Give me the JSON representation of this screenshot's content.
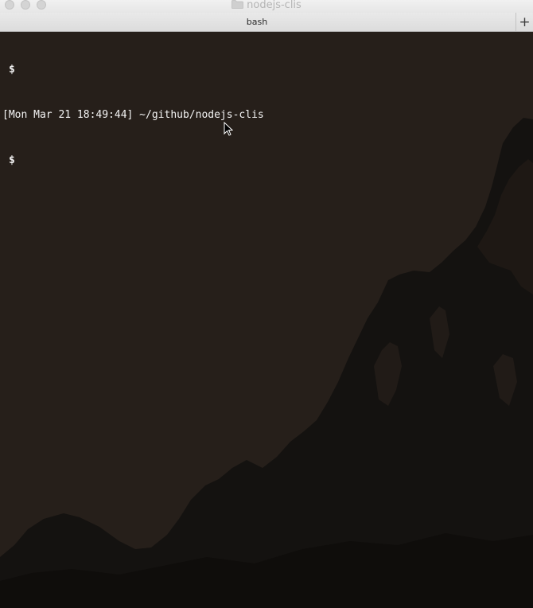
{
  "window": {
    "title": "nodejs-clis",
    "title_icon": "folder-icon"
  },
  "tabs": [
    {
      "label": "bash"
    }
  ],
  "new_tab_label": "+",
  "terminal": {
    "lines": [
      "$",
      "[Mon Mar 21 18:49:44] ~/github/nodejs-clis",
      "$"
    ]
  },
  "colors": {
    "background": "#261f1a",
    "mountain": "#141210",
    "text": "#f4f4f4"
  }
}
